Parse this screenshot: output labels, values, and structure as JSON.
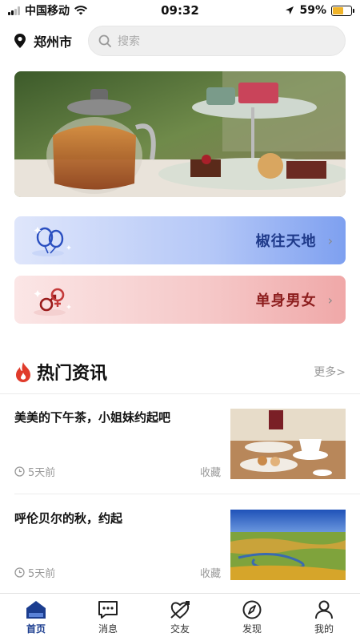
{
  "status": {
    "carrier": "中国移动",
    "time": "09:32",
    "battery": "59%",
    "battery_level": 0.59
  },
  "header": {
    "city": "郑州市",
    "search_placeholder": "搜索"
  },
  "categories": [
    {
      "label": "椒往天地"
    },
    {
      "label": "单身男女"
    }
  ],
  "section": {
    "title": "热门资讯",
    "more": "更多>"
  },
  "news": [
    {
      "title": "美美的下午茶，小姐妹约起吧",
      "time": "5天前",
      "action": "收藏"
    },
    {
      "title": "呼伦贝尔的秋，约起",
      "time": "5天前",
      "action": "收藏"
    }
  ],
  "tabs": [
    {
      "label": "首页",
      "icon": "home-icon",
      "active": true
    },
    {
      "label": "消息",
      "icon": "message-icon",
      "active": false
    },
    {
      "label": "交友",
      "icon": "dating-icon",
      "active": false
    },
    {
      "label": "发现",
      "icon": "compass-icon",
      "active": false
    },
    {
      "label": "我的",
      "icon": "profile-icon",
      "active": false
    }
  ],
  "colors": {
    "accent": "#1b3d8f",
    "card_blue": "#7ea0f0",
    "card_pink": "#f0a8a8",
    "fire": "#e03b2b"
  }
}
